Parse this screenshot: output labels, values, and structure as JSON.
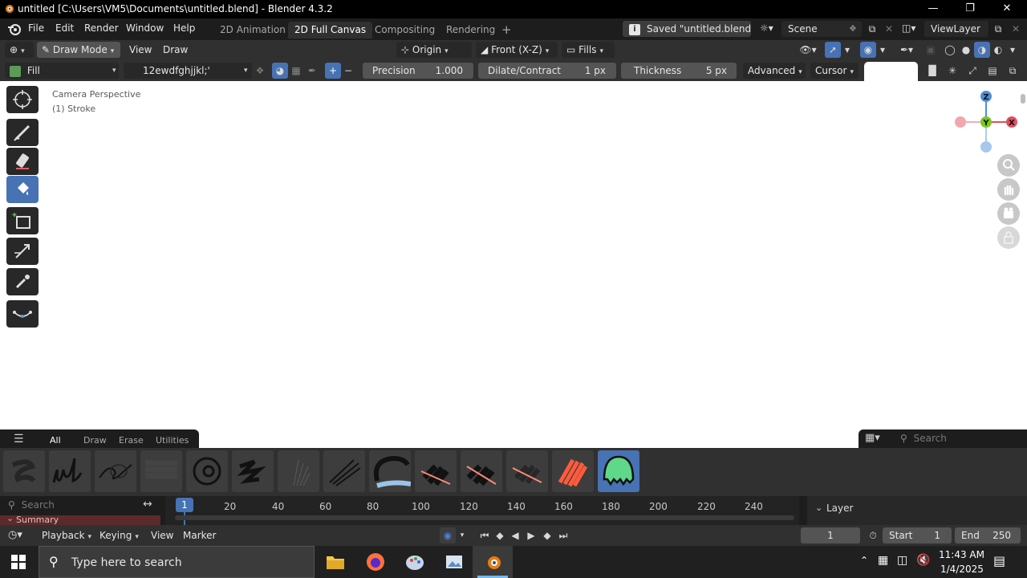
{
  "window": {
    "title": "untitled [C:\\Users\\VM5\\Documents\\untitled.blend] - Blender 4.3.2"
  },
  "menu": {
    "items": [
      "File",
      "Edit",
      "Render",
      "Window",
      "Help"
    ]
  },
  "workspaces": {
    "tabs": [
      "2D Animation",
      "2D Full Canvas",
      "Compositing",
      "Rendering"
    ],
    "active": "2D Full Canvas",
    "add_label": "+"
  },
  "status": {
    "saved_message": "Saved \"untitled.blend\""
  },
  "scene": {
    "name": "Scene"
  },
  "view_layer": {
    "name": "ViewLayer"
  },
  "header1": {
    "mode": "Draw Mode",
    "view_menu": "View",
    "draw_menu": "Draw",
    "pivot": "Origin",
    "orientation": "Front (X-Z)",
    "fills": "Fills"
  },
  "header2": {
    "tool": "Fill",
    "material": "12ewdfghjjkl;'",
    "precision_label": "Precision",
    "precision_value": "1.000",
    "dilate_label": "Dilate/Contract",
    "dilate_value": "1 px",
    "thickness_label": "Thickness",
    "thickness_value": "5 px",
    "advanced": "Advanced",
    "cursor": "Cursor",
    "plus": "+",
    "minus": "−"
  },
  "viewport": {
    "camera_text": "Camera Perspective",
    "object_text": "(1) Stroke",
    "gizmo": {
      "z": "Z",
      "y": "Y",
      "x": "X"
    }
  },
  "shelf": {
    "tabs": [
      "All",
      "Draw",
      "Erase",
      "Utilities"
    ],
    "active_tab": "All",
    "search_placeholder": "Search",
    "brush_count": 14,
    "active_brush_index": 13
  },
  "timeline": {
    "search_placeholder": "Search",
    "current_frame_marker": "1",
    "ruler": [
      "20",
      "40",
      "60",
      "80",
      "100",
      "120",
      "140",
      "160",
      "180",
      "200",
      "220",
      "240"
    ],
    "layer_label": "Layer",
    "summary_label": "Summary",
    "playback": "Playback",
    "keying": "Keying",
    "view": "View",
    "marker": "Marker",
    "current_frame": "1",
    "start_label": "Start",
    "start_value": "1",
    "end_label": "End",
    "end_value": "250"
  },
  "taskbar": {
    "search_placeholder": "Type here to search",
    "time": "11:43 AM",
    "date": "1/4/2025"
  },
  "colors": {
    "accent": "#4772b3",
    "axis_x": "#e0505f",
    "axis_y": "#7ac81e",
    "axis_z": "#4d8fd8"
  }
}
